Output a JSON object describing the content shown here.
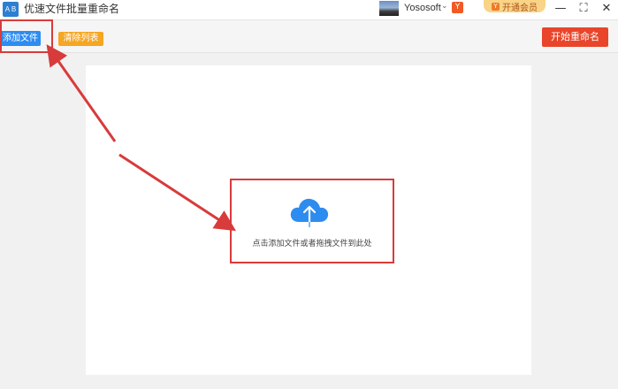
{
  "titlebar": {
    "app_icon_text": "A B",
    "title": "优速文件批量重命名",
    "username": "Yososoft",
    "brand_badge": "Y",
    "vip_label": "开通会员",
    "minimize": "—",
    "maximize": "⛶",
    "close": "✕"
  },
  "toolbar": {
    "add_files": "添加文件",
    "clear_list": "清除列表",
    "start_rename": "开始重命名"
  },
  "main": {
    "drop_hint": "点击添加文件或者拖拽文件到此处"
  },
  "colors": {
    "add_button": "#2d8cf0",
    "clear_button": "#f5a623",
    "start_button": "#e8452b",
    "annotation": "#d83b3b",
    "cloud_icon": "#2d8cf0"
  },
  "icons": {
    "app": "app-logo-icon",
    "upload": "cloud-upload-icon"
  }
}
